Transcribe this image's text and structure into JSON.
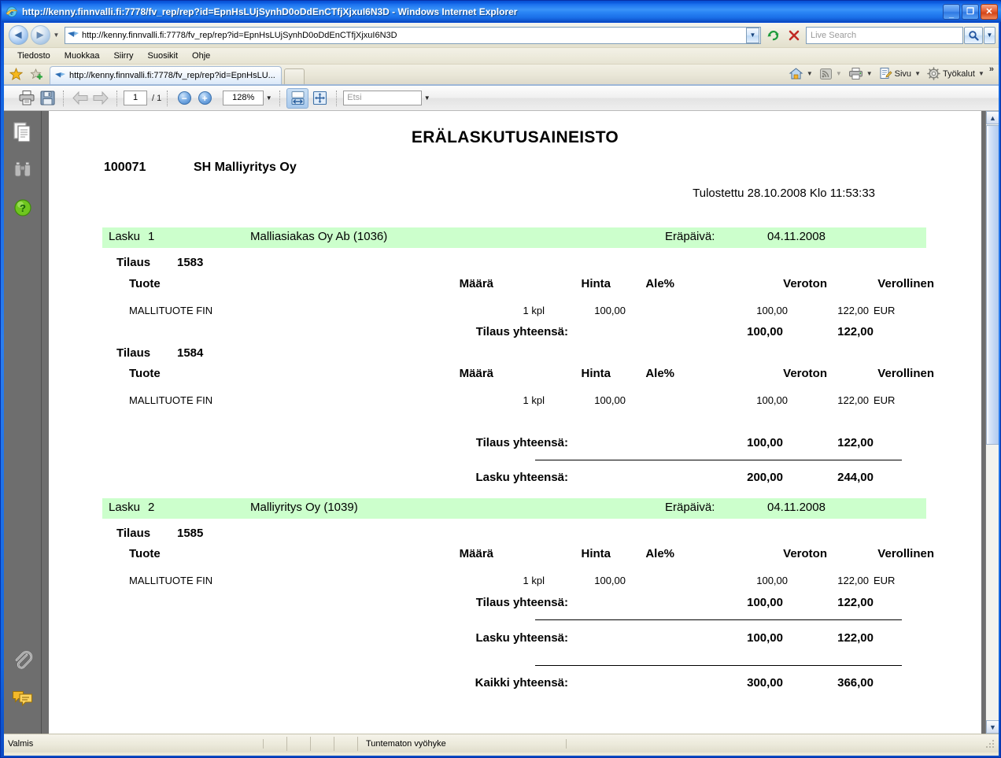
{
  "window": {
    "title": "http://kenny.finnvalli.fi:7778/fv_rep/rep?id=EpnHsLUjSynhD0oDdEnCTfjXjxuI6N3D - Windows Internet Explorer",
    "minimize_label": "_",
    "maximize_label": "❐",
    "close_label": "✕"
  },
  "address_bar": {
    "url": "http://kenny.finnvalli.fi:7778/fv_rep/rep?id=EpnHsLUjSynhD0oDdEnCTfjXjxuI6N3D",
    "back_glyph": "◄",
    "forward_glyph": "►",
    "refresh_glyph": "↻",
    "stop_glyph": "✕",
    "search_placeholder": "Live Search",
    "search_glyph": "🔍"
  },
  "menu": {
    "items": [
      {
        "label": "Tiedosto"
      },
      {
        "label": "Muokkaa"
      },
      {
        "label": "Siirry"
      },
      {
        "label": "Suosikit"
      },
      {
        "label": "Ohje"
      }
    ]
  },
  "tabs": {
    "active_label": "http://kenny.finnvalli.fi:7778/fv_rep/rep?id=EpnHsLU...",
    "commands": [
      {
        "name": "home",
        "label": ""
      },
      {
        "name": "feeds",
        "label": ""
      },
      {
        "name": "print",
        "label": ""
      },
      {
        "name": "page",
        "label": "Sivu"
      },
      {
        "name": "tools",
        "label": "Työkalut"
      }
    ],
    "overflow_glyph": "»"
  },
  "pdf_toolbar": {
    "print_title": "Tulosta",
    "save_title": "Tallenna",
    "prev_glyph": "⬅",
    "next_glyph": "➡",
    "page_value": "1",
    "page_total": "/ 1",
    "zoom_out_label": "−",
    "zoom_in_label": "+",
    "zoom_value": "128%",
    "fit_width_title": "Sovita leveyteen",
    "fit_page_title": "Sovita sivu",
    "find_placeholder": "Etsi",
    "dropdown_glyph": "▼"
  },
  "pdf_sidebar": {
    "icons": [
      {
        "name": "pages-panel-icon"
      },
      {
        "name": "binoculars-search-icon"
      },
      {
        "name": "help-icon"
      },
      {
        "name": "attachments-paperclip-icon"
      },
      {
        "name": "comments-icon"
      }
    ]
  },
  "scrollbar": {
    "up_glyph": "▲",
    "down_glyph": "▼"
  },
  "document": {
    "title": "ERÄLASKUTUSAINEISTO",
    "company_number": "100071",
    "company_name": "SH Malliyritys Oy",
    "printed_line": "Tulostettu 28.10.2008 Klo 11:53:33",
    "labels": {
      "invoice": "Lasku",
      "order": "Tilaus",
      "due_date": "Eräpäivä:",
      "order_total": "Tilaus yhteensä:",
      "invoice_total": "Lasku yhteensä:",
      "grand_total": "Kaikki yhteensä:"
    },
    "columns": {
      "product": "Tuote",
      "quantity": "Määrä",
      "price": "Hinta",
      "discount": "Ale%",
      "net": "Veroton",
      "gross": "Verollinen"
    },
    "invoices": [
      {
        "number": "1",
        "customer": "Malliasiakas Oy Ab  (1036)",
        "due_date": "04.11.2008",
        "orders": [
          {
            "number": "1583",
            "lines": [
              {
                "product": "MALLITUOTE FIN",
                "qty": "1 kpl",
                "price": "100,00",
                "discount": "",
                "net": "100,00",
                "gross": "122,00",
                "currency": "EUR"
              }
            ],
            "total_net": "100,00",
            "total_gross": "122,00"
          },
          {
            "number": "1584",
            "lines": [
              {
                "product": "MALLITUOTE FIN",
                "qty": "1 kpl",
                "price": "100,00",
                "discount": "",
                "net": "100,00",
                "gross": "122,00",
                "currency": "EUR"
              }
            ],
            "total_net": "100,00",
            "total_gross": "122,00"
          }
        ],
        "total_net": "200,00",
        "total_gross": "244,00"
      },
      {
        "number": "2",
        "customer": "Malliyritys Oy  (1039)",
        "due_date": "04.11.2008",
        "orders": [
          {
            "number": "1585",
            "lines": [
              {
                "product": "MALLITUOTE FIN",
                "qty": "1 kpl",
                "price": "100,00",
                "discount": "",
                "net": "100,00",
                "gross": "122,00",
                "currency": "EUR"
              }
            ],
            "total_net": "100,00",
            "total_gross": "122,00"
          }
        ],
        "total_net": "100,00",
        "total_gross": "122,00"
      }
    ],
    "grand_total_net": "300,00",
    "grand_total_gross": "366,00"
  },
  "status_bar": {
    "left": "Valmis",
    "zone": "Tuntematon vyöhyke"
  },
  "colors": {
    "invoice_bar_green": "#ccffcc",
    "title_bar_blue": "#2a7ef0",
    "chrome_beige": "#ece9d8",
    "pdf_backdrop": "#6e6e6e"
  }
}
